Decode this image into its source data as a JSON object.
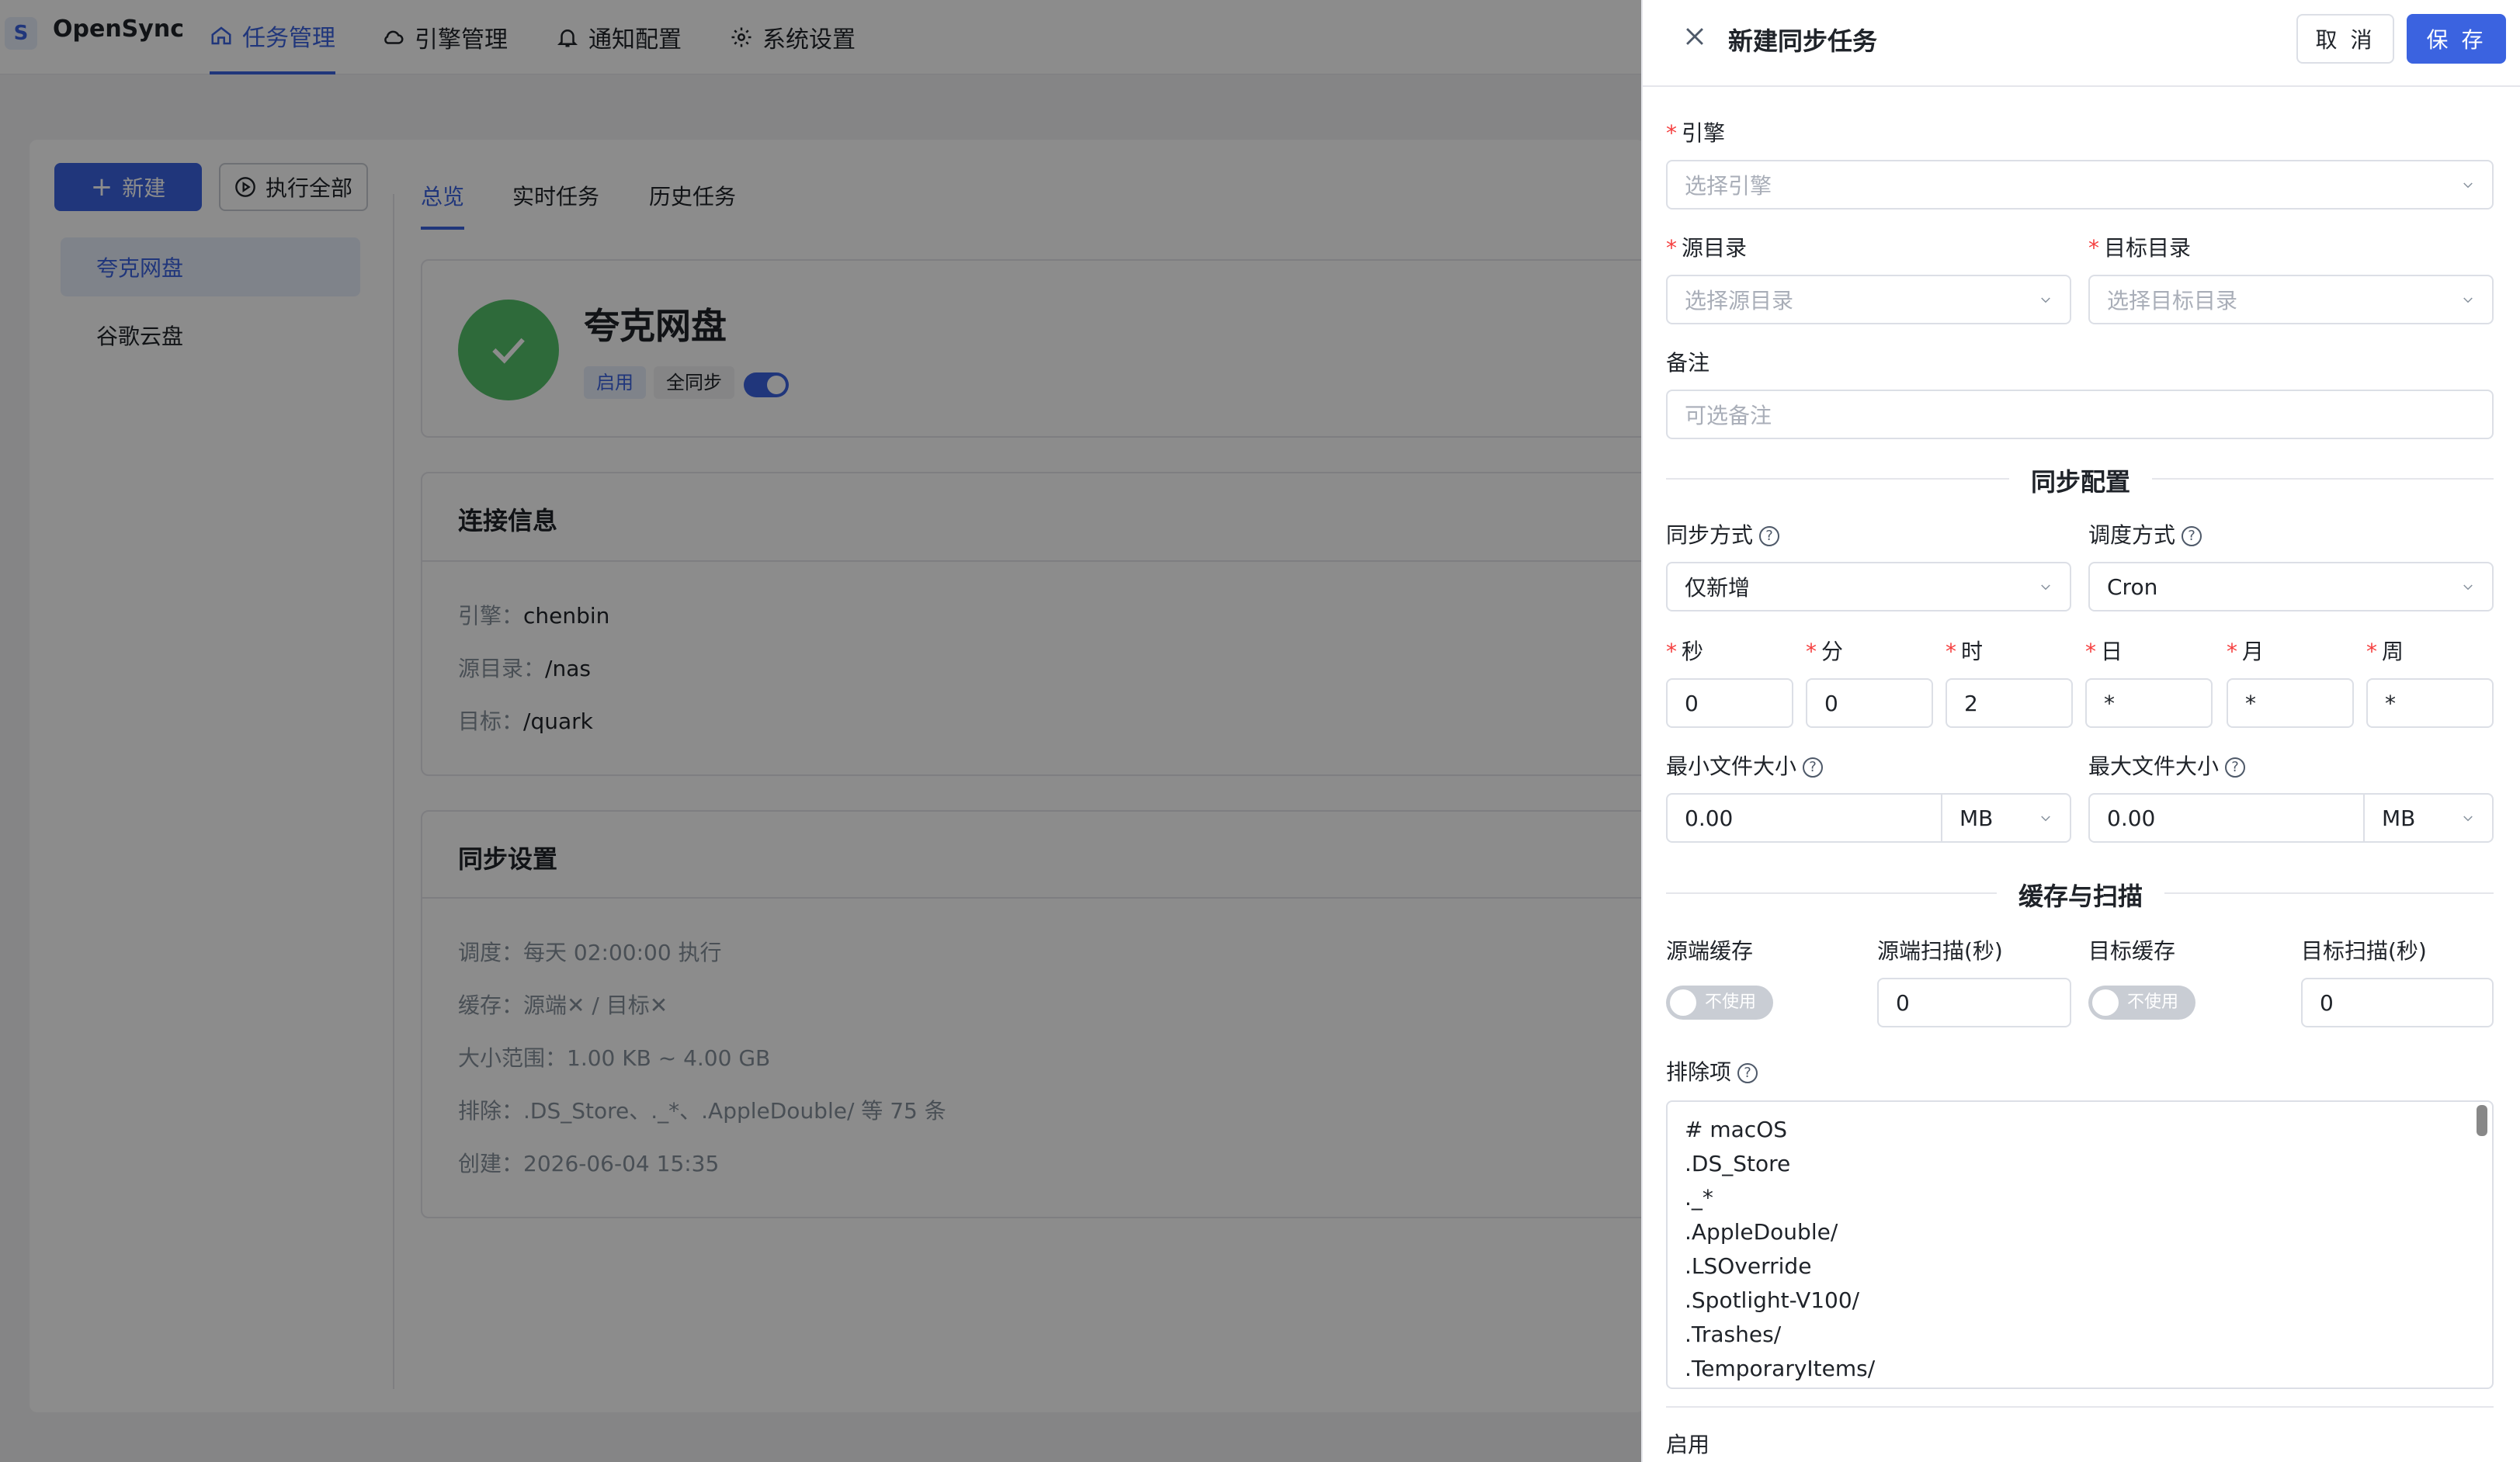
{
  "app": {
    "name": "OpenSync",
    "logo_letter": "S"
  },
  "nav": [
    {
      "label": "任务管理",
      "icon": "home-icon"
    },
    {
      "label": "引擎管理",
      "icon": "cloud-icon"
    },
    {
      "label": "通知配置",
      "icon": "bell-icon"
    },
    {
      "label": "系统设置",
      "icon": "gear-icon"
    }
  ],
  "toolbar": {
    "new_label": "新建",
    "run_all_label": "执行全部"
  },
  "sidebar": {
    "items": [
      {
        "label": "夸克网盘"
      },
      {
        "label": "谷歌云盘"
      }
    ]
  },
  "tabs": [
    {
      "label": "总览"
    },
    {
      "label": "实时任务"
    },
    {
      "label": "历史任务"
    }
  ],
  "task": {
    "name": "夸克网盘",
    "tag_enabled": "启用",
    "tag_mode": "全同步",
    "enabled": true
  },
  "connection": {
    "title": "连接信息",
    "engine_key": "引擎：",
    "engine": "chenbin",
    "source_key": "源目录：",
    "source": "/nas",
    "target_key": "目标：",
    "target": "/quark"
  },
  "sync_settings": {
    "title": "同步设置",
    "schedule": "调度：每天 02:00:00 执行",
    "cache": "缓存：源端✕ / 目标✕",
    "size": "大小范围：1.00 KB ~ 4.00 GB",
    "exclude": "排除：.DS_Store、._*、.AppleDouble/ 等 75 条",
    "created": "创建：2026-06-04 15:35"
  },
  "drawer": {
    "title": "新建同步任务",
    "cancel": "取 消",
    "save": "保 存",
    "engine_label": "引擎",
    "engine_placeholder": "选择引擎",
    "source_label": "源目录",
    "source_placeholder": "选择源目录",
    "target_label": "目标目录",
    "target_placeholder": "选择目标目录",
    "remark_label": "备注",
    "remark_placeholder": "可选备注",
    "sync_config_title": "同步配置",
    "sync_mode_label": "同步方式",
    "sync_mode_value": "仅新增",
    "schedule_label": "调度方式",
    "schedule_value": "Cron",
    "cron": [
      {
        "label": "秒",
        "value": "0"
      },
      {
        "label": "分",
        "value": "0"
      },
      {
        "label": "时",
        "value": "2"
      },
      {
        "label": "日",
        "value": "*"
      },
      {
        "label": "月",
        "value": "*"
      },
      {
        "label": "周",
        "value": "*"
      }
    ],
    "min_size_label": "最小文件大小",
    "min_size_value": "0.00",
    "min_size_unit": "MB",
    "max_size_label": "最大文件大小",
    "max_size_value": "0.00",
    "max_size_unit": "MB",
    "cache_scan_title": "缓存与扫描",
    "src_cache_label": "源端缓存",
    "src_cache_toggle": "不使用",
    "src_scan_label": "源端扫描(秒)",
    "src_scan_value": "0",
    "dst_cache_label": "目标缓存",
    "dst_cache_toggle": "不使用",
    "dst_scan_label": "目标扫描(秒)",
    "dst_scan_value": "0",
    "exclude_label": "排除项",
    "exclude_lines": [
      "# macOS",
      ".DS_Store",
      "._*",
      ".AppleDouble/",
      ".LSOverride",
      ".Spotlight-V100/",
      ".Trashes/",
      ".TemporaryItems/"
    ],
    "enable_label": "启用"
  },
  "colors": {
    "accent": "#3b63e0",
    "success": "#55c16b",
    "required": "#f53f3f"
  }
}
